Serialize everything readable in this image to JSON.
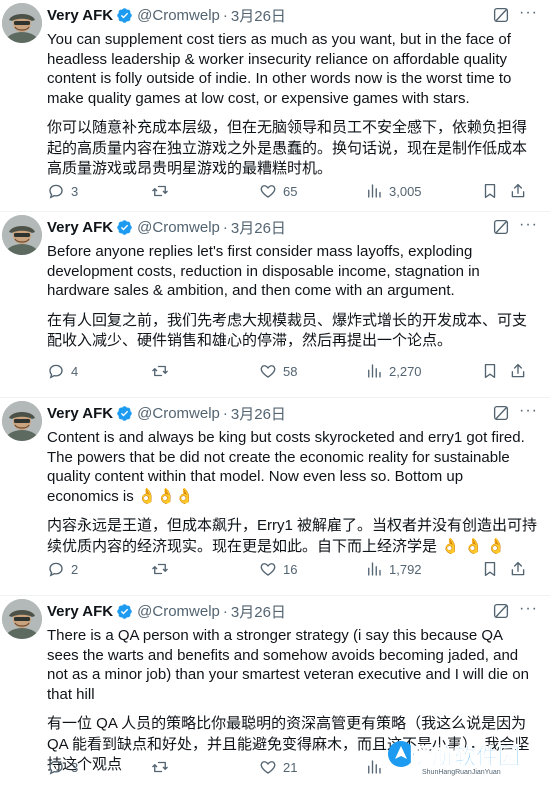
{
  "author": {
    "name": "Very AFK",
    "handle": "@Cromwelp",
    "separator": "·",
    "date": "3月26日"
  },
  "tweets": [
    {
      "text_en": "You can supplement cost tiers as much as you want, but in the face of headless leadership & worker insecurity reliance on affordable quality content is folly outside of indie. In other words now is the worst time to make quality games at low cost, or expensive games with stars.",
      "text_zh": "你可以随意补充成本层级，但在无脑领导和员工不安全感下，依赖负担得起的高质量内容在独立游戏之外是愚蠢的。换句话说，现在是制作低成本高质量游戏或昂贵明星游戏的最糟糕时机。",
      "replies": "3",
      "retweets": "",
      "likes": "65",
      "views": "3,005"
    },
    {
      "text_en": "Before anyone replies let's first consider mass layoffs, exploding development costs, reduction in disposable income, stagnation in hardware sales & ambition, and then come with an argument.",
      "text_zh": "在有人回复之前，我们先考虑大规模裁员、爆炸式增长的开发成本、可支配收入减少、硬件销售和雄心的停滞，然后再提出一个论点。",
      "replies": "4",
      "retweets": "",
      "likes": "58",
      "views": "2,270"
    },
    {
      "text_en": "Content is and always be king but costs skyrocketed and erry1 got fired. The powers that be did not create the economic reality for sustainable quality content within that model. Now even less so. Bottom up economics is 👌👌👌",
      "text_zh": "内容永远是王道，但成本飙升，Erry1 被解雇了。当权者并没有创造出可持续优质内容的经济现实。现在更是如此。自下而上经济学是 👌 👌 👌",
      "replies": "2",
      "retweets": "",
      "likes": "16",
      "views": "1,792"
    },
    {
      "text_en": "There is a QA person with a stronger strategy (i say this because QA sees the warts and benefits and somehow avoids becoming jaded, and not as a minor job) than your smartest veteran executive and I will die on that hill",
      "text_zh": "有一位 QA 人员的策略比你最聪明的资深高管更有策略（我这么说是因为 QA 能看到缺点和好处，并且能避免变得麻木，而且这不是小事），我会坚持这个观点",
      "replies": "3",
      "retweets": "",
      "likes": "21",
      "views": ""
    }
  ],
  "watermark": {
    "title": "瞬航软件园",
    "subtitle": "ShunHangRuanJianYuan"
  },
  "colors": {
    "text": "#0f1419",
    "secondary": "#536471",
    "verified": "#1d9bf0",
    "divider": "#eff3f4"
  },
  "icons": [
    "verified-badge-icon",
    "grok-icon",
    "more-icon",
    "reply-icon",
    "retweet-icon",
    "like-icon",
    "views-icon",
    "bookmark-icon",
    "share-icon",
    "avatar"
  ]
}
